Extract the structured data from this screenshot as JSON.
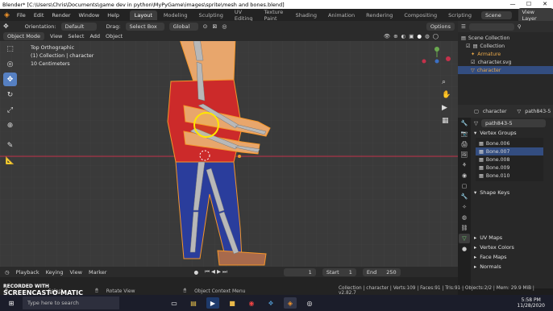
{
  "window": {
    "title": "Blender* [C:\\Users\\Chris\\Documents\\game dev in python\\MyPyGame\\images\\sprite\\mesh and bones.blend]",
    "controls": [
      "—",
      "☐",
      "✕"
    ]
  },
  "menu": {
    "logo": "◈",
    "items": [
      "File",
      "Edit",
      "Render",
      "Window",
      "Help"
    ],
    "workspaces": [
      "Layout",
      "Modeling",
      "Sculpting",
      "UV Editing",
      "Texture Paint",
      "Shading",
      "Animation",
      "Rendering",
      "Compositing",
      "Scripting"
    ],
    "active_workspace": "Layout",
    "scene_label": "Scene",
    "viewlayer_label": "View Layer"
  },
  "viewport_header": {
    "orientation_label": "Orientation:",
    "orientation_value": "Default",
    "drag_label": "Drag:",
    "drag_value": "Select Box",
    "transform_value": "Global",
    "options_label": "Options"
  },
  "viewport_header2": {
    "mode": "Object Mode",
    "menus": [
      "View",
      "Select",
      "Add",
      "Object"
    ]
  },
  "viewport": {
    "view_name": "Top Orthographic",
    "collection_line": "(1) Collection | character",
    "scale_line": "10 Centimeters"
  },
  "outliner": {
    "search_placeholder": "",
    "rows": [
      {
        "label": "Scene Collection",
        "indent": 0,
        "selected": false
      },
      {
        "label": "Collection",
        "indent": 1,
        "selected": false
      },
      {
        "label": "Armature",
        "indent": 2,
        "selected": false,
        "color": "#e8a84a"
      },
      {
        "label": "character.svg",
        "indent": 2,
        "selected": false
      },
      {
        "label": "character",
        "indent": 2,
        "selected": true,
        "color": "#e8a84a"
      }
    ]
  },
  "properties": {
    "breadcrumb_object": "character",
    "breadcrumb_data": "path843-5",
    "data_name": "path843-5",
    "vertex_groups_title": "Vertex Groups",
    "vertex_groups": [
      {
        "label": "Bone.006",
        "selected": false
      },
      {
        "label": "Bone.007",
        "selected": true
      },
      {
        "label": "Bone.008",
        "selected": false
      },
      {
        "label": "Bone.009",
        "selected": false
      },
      {
        "label": "Bone.010",
        "selected": false
      }
    ],
    "shape_keys_title": "Shape Keys",
    "uv_maps_title": "UV Maps",
    "vertex_colors_title": "Vertex Colors",
    "face_maps_title": "Face Maps",
    "normals_title": "Normals"
  },
  "timeline": {
    "menus": [
      "Playback",
      "Keying",
      "View",
      "Marker"
    ],
    "current_frame": "1",
    "start_label": "Start",
    "start_value": "1",
    "end_label": "End",
    "end_value": "250"
  },
  "statusbar": {
    "select_label": "Select",
    "rotate_label": "Rotate View",
    "context_label": "Object Context Menu",
    "stats": "Collection | character | Verts:109 | Faces:91 | Tris:91 | Objects:2/2 | Mem: 29.9 MiB | v2.82.7"
  },
  "taskbar": {
    "search_placeholder": "Type here to search",
    "time": "5:58 PM",
    "date": "11/28/2020"
  },
  "watermark": {
    "line1": "RECORDED WITH",
    "line2": "SCREENCAST-O-MATIC"
  },
  "colors": {
    "accent": "#5680c2",
    "selection": "#334d80",
    "shirt": "#cc2a2a",
    "pants": "#2a3d9c",
    "skin": "#e8a66c",
    "bone": "#b8b8b8",
    "outline": "#f5962a",
    "xaxis": "#c4314b"
  }
}
